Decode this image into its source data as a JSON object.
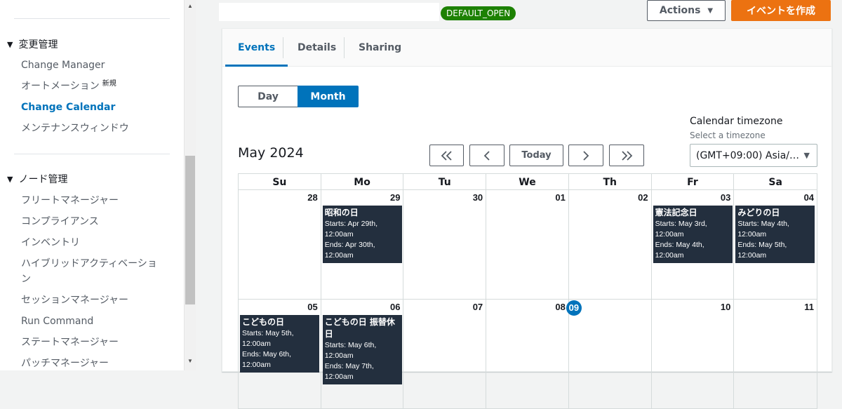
{
  "sidebar": {
    "sections": [
      {
        "title": "変更管理",
        "items": [
          {
            "label": "Change Manager",
            "badge": ""
          },
          {
            "label": "オートメーション",
            "badge": "新規"
          },
          {
            "label": "Change Calendar",
            "badge": ""
          },
          {
            "label": "メンテナンスウィンドウ",
            "badge": ""
          }
        ]
      },
      {
        "title": "ノード管理",
        "items": [
          {
            "label": "フリートマネージャー"
          },
          {
            "label": "コンプライアンス"
          },
          {
            "label": "インベントリ"
          },
          {
            "label": "ハイブリッドアクティベーション"
          },
          {
            "label": "セッションマネージャー"
          },
          {
            "label": "Run Command"
          },
          {
            "label": "ステートマネージャー"
          },
          {
            "label": "パッチマネージャー"
          }
        ]
      }
    ]
  },
  "header": {
    "status_badge": "DEFAULT_OPEN",
    "actions_label": "Actions",
    "create_label": "イベントを作成"
  },
  "tabs": [
    {
      "label": "Events"
    },
    {
      "label": "Details"
    },
    {
      "label": "Sharing"
    }
  ],
  "view_toggle": {
    "day": "Day",
    "month": "Month"
  },
  "timezone": {
    "label": "Calendar timezone",
    "hint": "Select a timezone",
    "value": "(GMT+09:00) Asia/…"
  },
  "calendar": {
    "month_title": "May  2024",
    "today_label": "Today",
    "weekdays": [
      "Su",
      "Mo",
      "Tu",
      "We",
      "Th",
      "Fr",
      "Sa"
    ],
    "week1": {
      "days": [
        "28",
        "29",
        "30",
        "01",
        "02",
        "03",
        "04"
      ],
      "events": {
        "mo": {
          "title": "昭和の日",
          "starts": "Starts: Apr 29th, 12:00am",
          "ends": "Ends: Apr 30th, 12:00am"
        },
        "fr": {
          "title": "憲法記念日",
          "starts": "Starts: May 3rd, 12:00am",
          "ends": "Ends: May 4th, 12:00am"
        },
        "sa": {
          "title": "みどりの日",
          "starts": "Starts: May 4th, 12:00am",
          "ends": "Ends: May 5th, 12:00am"
        }
      }
    },
    "week2": {
      "days": [
        "05",
        "06",
        "07",
        "08",
        "09",
        "10",
        "11"
      ],
      "events": {
        "su": {
          "title": "こどもの日",
          "starts": "Starts: May 5th, 12:00am",
          "ends": "Ends: May 6th, 12:00am"
        },
        "mo": {
          "title": "こどもの日 振替休日",
          "starts": "Starts: May 6th, 12:00am",
          "ends": "Ends: May 7th, 12:00am"
        }
      }
    }
  },
  "colors": {
    "accent": "#0073bb",
    "create_button": "#ec7211",
    "status_green": "#1d8102",
    "event_bg": "#232f3e"
  }
}
